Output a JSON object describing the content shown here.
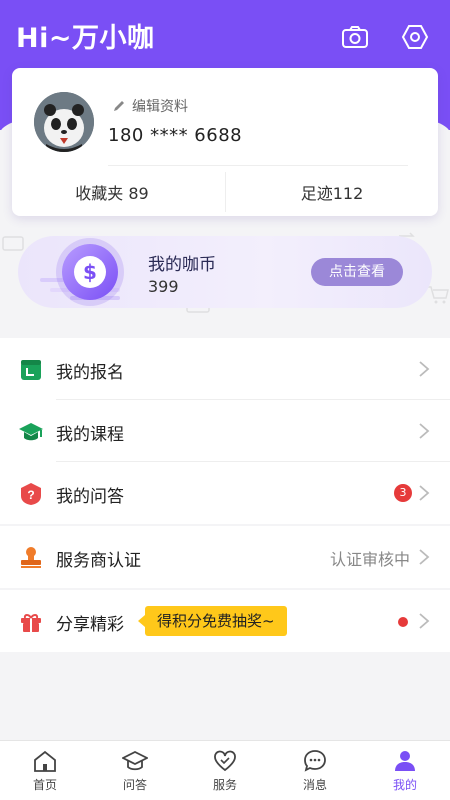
{
  "header": {
    "title": "Hi~万小咖",
    "camera_icon": "camera-icon",
    "settings_icon": "hexagon-settings-icon",
    "bg_color": "#7a4ff5"
  },
  "profile": {
    "edit_label": "编辑资料",
    "phone": "180 **** 6688",
    "favorites": "收藏夹 89",
    "footprints": "足迹112"
  },
  "coins": {
    "title": "我的咖币",
    "value": "399",
    "button": "点击查看"
  },
  "menu": {
    "registration": "我的报名",
    "courses": "我的课程",
    "qa": "我的问答",
    "qa_badge": "3",
    "provider": "服务商认证",
    "provider_status": "认证审核中",
    "share": "分享精彩",
    "share_promo": "得积分免费抽奖~"
  },
  "tabs": [
    {
      "label": "首页",
      "icon": "home-icon"
    },
    {
      "label": "问答",
      "icon": "graduation-cap-icon"
    },
    {
      "label": "服务",
      "icon": "heart-icon"
    },
    {
      "label": "消息",
      "icon": "chat-bubble-icon"
    },
    {
      "label": "我的",
      "icon": "user-icon"
    }
  ],
  "active_tab": "我的"
}
